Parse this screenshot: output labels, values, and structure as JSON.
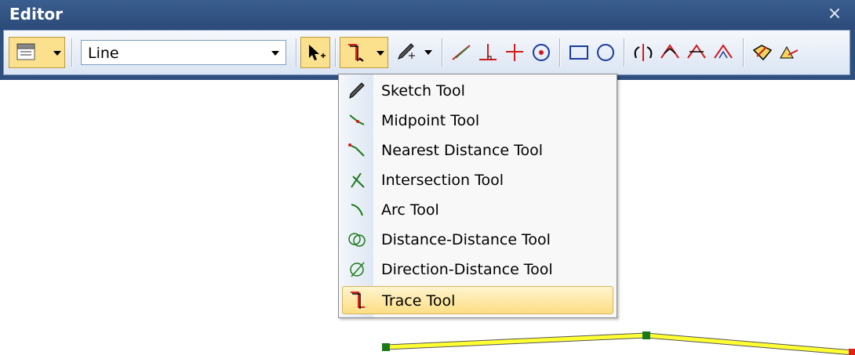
{
  "window": {
    "title": "Editor",
    "close_label": "×"
  },
  "toolbar": {
    "target_layer": "Line",
    "buttons": [
      "editor-menu-icon",
      "edit-tool-icon",
      "trace-tool-icon",
      "sketch-tool-icon",
      "endpoint-arc-icon",
      "perpendicular-icon",
      "parallel-icon",
      "rotate-icon",
      "rectangle-icon",
      "circle-icon",
      "split-icon",
      "union-icon",
      "intersect-icon",
      "clip-icon",
      "topology-icon",
      "attributes-icon"
    ]
  },
  "menu": {
    "items": [
      {
        "label": "Sketch Tool",
        "icon": "pencil-icon"
      },
      {
        "label": "Midpoint Tool",
        "icon": "midpoint-icon"
      },
      {
        "label": "Nearest Distance Tool",
        "icon": "nearest-distance-icon"
      },
      {
        "label": "Intersection Tool",
        "icon": "intersection-icon"
      },
      {
        "label": "Arc Tool",
        "icon": "arc-icon"
      },
      {
        "label": "Distance-Distance Tool",
        "icon": "distance-distance-icon"
      },
      {
        "label": "Direction-Distance Tool",
        "icon": "direction-distance-icon"
      },
      {
        "label": "Trace Tool",
        "icon": "trace-icon",
        "selected": true
      }
    ]
  },
  "colors": {
    "title_bar": "#2f4f7f",
    "toolbar": "#dbe5f3",
    "highlight": "#fbe08e",
    "polyline": "#ffff00",
    "vertex": "#1a7a1a",
    "end_vertex": "#e02020"
  }
}
